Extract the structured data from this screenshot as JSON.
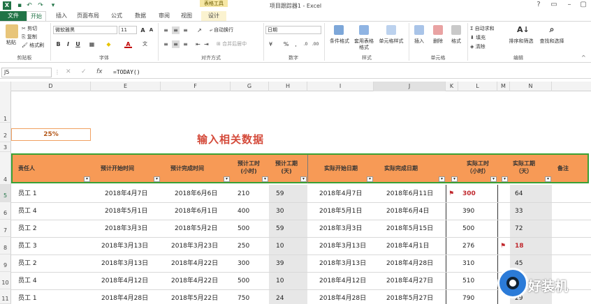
{
  "window": {
    "title": "项目跟踪器1 - Excel",
    "context_tab_header": "表格工具"
  },
  "tabs": [
    "文件",
    "开始",
    "插入",
    "页面布局",
    "公式",
    "数据",
    "审阅",
    "视图",
    "设计"
  ],
  "clipboard": {
    "paste": "粘贴",
    "cut": "剪切",
    "copy": "复制",
    "format_painter": "格式刷",
    "label": "剪贴板"
  },
  "font": {
    "name": "微软雅黑",
    "size": "11",
    "label": "字体",
    "bold": "B",
    "italic": "I",
    "underline": "U"
  },
  "alignment": {
    "wrap": "自动换行",
    "merge": "合并后居中",
    "label": "对齐方式"
  },
  "number": {
    "format": "日期",
    "label": "数字",
    "percent": "%",
    "comma": ","
  },
  "styles": {
    "cond": "条件格式",
    "table": "套用表格格式",
    "cell": "单元格样式",
    "label": "样式"
  },
  "cells": {
    "insert": "插入",
    "delete": "删除",
    "format": "格式",
    "label": "单元格"
  },
  "editing": {
    "autosum": "自动求和",
    "fill": "填充",
    "clear": "清除",
    "sort": "排序和筛选",
    "find": "查找和选择",
    "label": "编辑"
  },
  "formula_bar": {
    "name": "J5",
    "formula": "=TODAY()",
    "fx": "fx"
  },
  "columns": [
    "D",
    "E",
    "F",
    "G",
    "H",
    "I",
    "J",
    "K",
    "L",
    "M",
    "N"
  ],
  "row_numbers": [
    "1",
    "2",
    "3",
    "4",
    "5",
    "6",
    "7",
    "8",
    "9",
    "10",
    "11"
  ],
  "sheet": {
    "percent": "25%",
    "title": "输入相关数据"
  },
  "headers": {
    "owner": "责任人",
    "plan_start": "预计开始时间",
    "plan_end": "预计完成时间",
    "plan_hours": "预计工时\n(小时)",
    "plan_days": "预计工期\n(天)",
    "act_start": "实际开始日期",
    "act_end": "实际完成日期",
    "act_hours": "实际工时\n（小时）",
    "act_days": "实际工期\n（天）",
    "note": "备注"
  },
  "rows": [
    {
      "owner": "员工 1",
      "ps": "2018年4月7日",
      "pe": "2018年6月6日",
      "ph": "210",
      "pd": "59",
      "as": "2018年4月7日",
      "ae": "2018年6月11日",
      "ah": "300",
      "ad": "64"
    },
    {
      "owner": "员工 4",
      "ps": "2018年5月1日",
      "pe": "2018年6月1日",
      "ph": "400",
      "pd": "30",
      "as": "2018年5月1日",
      "ae": "2018年6月4日",
      "ah": "390",
      "ad": "33"
    },
    {
      "owner": "员工 2",
      "ps": "2018年3月3日",
      "pe": "2018年5月2日",
      "ph": "500",
      "pd": "59",
      "as": "2018年3月3日",
      "ae": "2018年5月15日",
      "ah": "500",
      "ad": "72"
    },
    {
      "owner": "员工 3",
      "ps": "2018年3月13日",
      "pe": "2018年3月23日",
      "ph": "250",
      "pd": "10",
      "as": "2018年3月13日",
      "ae": "2018年4月1日",
      "ah": "276",
      "ad": "18"
    },
    {
      "owner": "员工 2",
      "ps": "2018年3月13日",
      "pe": "2018年4月22日",
      "ph": "300",
      "pd": "39",
      "as": "2018年3月13日",
      "ae": "2018年4月28日",
      "ah": "310",
      "ad": "45"
    },
    {
      "owner": "员工 4",
      "ps": "2018年4月12日",
      "pe": "2018年4月22日",
      "ph": "500",
      "pd": "10",
      "as": "2018年4月12日",
      "ae": "2018年4月27日",
      "ah": "510",
      "ad": "15"
    },
    {
      "owner": "员工 1",
      "ps": "2018年4月28日",
      "pe": "2018年5月22日",
      "ph": "750",
      "pd": "24",
      "as": "2018年4月28日",
      "ae": "2018年5月27日",
      "ah": "790",
      "ad": "29"
    }
  ],
  "watermark": "好装机",
  "colors": {
    "accent": "#217346",
    "header_fill": "#f79a56",
    "header_border": "#3aa135",
    "alert": "#c0282d"
  }
}
